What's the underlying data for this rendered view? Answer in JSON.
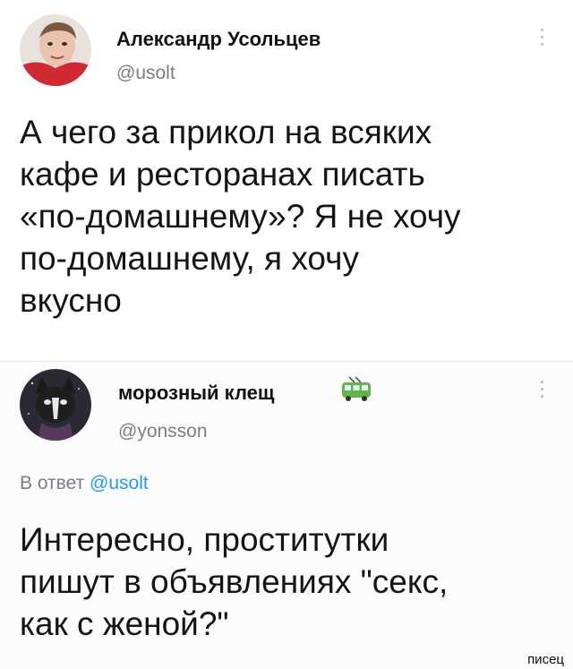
{
  "tweets": [
    {
      "author_name": "Александр Усольцев",
      "handle": "@usolt",
      "text_lines": [
        "А чего за прикол на всяких",
        "кафе и ресторанах писать",
        "«по-домашнему»? Я не хочу",
        "по-домашнему, я хочу",
        "вкусно"
      ]
    },
    {
      "author_name": "морозный клещ",
      "handle": "@yonsson",
      "name_emoji": "trolleybus-emoji",
      "reply_prefix": "В ответ",
      "reply_handle": "@usolt",
      "text_lines": [
        "Интересно, проститутки",
        "пишут в объявлениях \"секс,",
        "как с женой?\""
      ]
    }
  ],
  "watermark": "писец",
  "colors": {
    "link": "#1d9bf0",
    "muted": "#7a7f86",
    "text": "#111111"
  }
}
